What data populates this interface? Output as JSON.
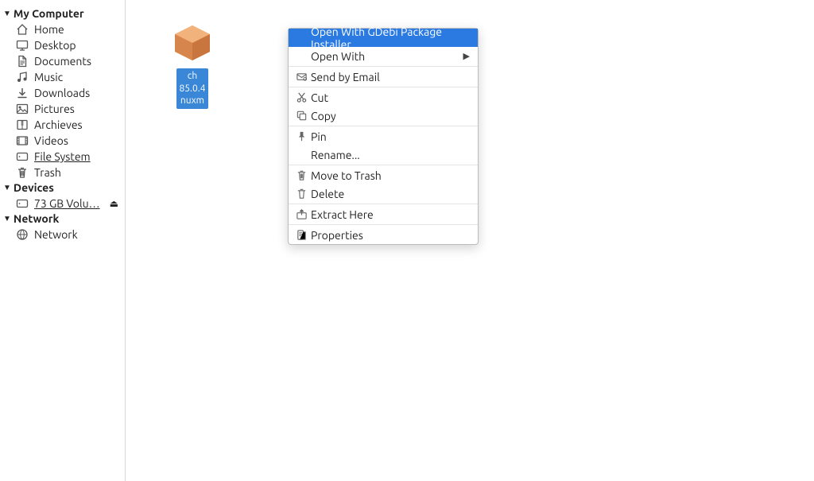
{
  "sidebar": {
    "categories": [
      {
        "name": "My Computer",
        "items": [
          {
            "icon": "home-icon",
            "label": "Home"
          },
          {
            "icon": "desktop-icon",
            "label": "Desktop"
          },
          {
            "icon": "documents-icon",
            "label": "Documents"
          },
          {
            "icon": "music-icon",
            "label": "Music"
          },
          {
            "icon": "downloads-icon",
            "label": "Downloads"
          },
          {
            "icon": "pictures-icon",
            "label": "Pictures"
          },
          {
            "icon": "archives-icon",
            "label": "Archieves"
          },
          {
            "icon": "videos-icon",
            "label": "Videos"
          },
          {
            "icon": "filesystem-icon",
            "label": "File System",
            "underline": true
          },
          {
            "icon": "trash-icon",
            "label": "Trash"
          }
        ]
      },
      {
        "name": "Devices",
        "items": [
          {
            "icon": "volume-icon",
            "label": "73 GB Volu…",
            "underline": true,
            "eject": true
          }
        ]
      },
      {
        "name": "Network",
        "items": [
          {
            "icon": "network-icon",
            "label": "Network"
          }
        ]
      }
    ]
  },
  "file": {
    "selected": true,
    "icon": "deb-package-icon",
    "name_line1": "ch",
    "name_line2": "85.0.4",
    "name_line3": "nuxm"
  },
  "context_menu": {
    "highlighted_index": 0,
    "items": [
      {
        "icon": "",
        "label": "Open With GDebi Package Installer"
      },
      {
        "icon": "",
        "label": "Open With",
        "submenu": true,
        "sep_after": true
      },
      {
        "icon": "mail-icon",
        "label": "Send by Email",
        "sep_after": true
      },
      {
        "icon": "cut-icon",
        "label": "Cut"
      },
      {
        "icon": "copy-icon",
        "label": "Copy",
        "sep_after": true
      },
      {
        "icon": "pin-icon",
        "label": "Pin"
      },
      {
        "icon": "",
        "label": "Rename...",
        "sep_after": true
      },
      {
        "icon": "trash-bin-icon",
        "label": "Move to Trash"
      },
      {
        "icon": "delete-icon",
        "label": "Delete",
        "sep_after": true
      },
      {
        "icon": "extract-icon",
        "label": "Extract Here",
        "sep_after": true
      },
      {
        "icon": "properties-icon",
        "label": "Properties"
      }
    ]
  },
  "icons_svg": {
    "home-icon": "<svg width='16' height='16' viewBox='0 0 16 16'><path fill='none' stroke='#555' stroke-width='1.3' d='M2 8 L8 2 L14 8 M3.5 7 V14 H12.5 V7'/></svg>",
    "desktop-icon": "<svg width='16' height='16' viewBox='0 0 16 16'><rect x='1.5' y='2.5' width='13' height='9' rx='1' fill='none' stroke='#555' stroke-width='1.3'/><path stroke='#555' stroke-width='1.3' d='M5 14 H11 M8 11.5 V14'/></svg>",
    "documents-icon": "<svg width='16' height='16' viewBox='0 0 16 16'><path fill='none' stroke='#555' stroke-width='1.3' d='M4 1.5 H9 L12.5 5 V14.5 H4 Z'/><path fill='none' stroke='#555' stroke-width='1.2' d='M9 1.5 V5 H12.5'/><path stroke='#555' stroke-width='1' d='M5.5 8 H11 M5.5 10 H11 M5.5 12 H9'/></svg>",
    "music-icon": "<svg width='16' height='16' viewBox='0 0 16 16'><path fill='none' stroke='#555' stroke-width='1.3' d='M5.5 12 V3.5 L13 2 V10.5'/><circle cx='4' cy='12' r='2' fill='#555'/><circle cx='11.5' cy='10.5' r='2' fill='#555'/></svg>",
    "downloads-icon": "<svg width='16' height='16' viewBox='0 0 16 16'><path fill='none' stroke='#555' stroke-width='1.5' d='M8 2 V10 M4.5 7 L8 10.5 L11.5 7 M2.5 13.5 H13.5'/></svg>",
    "pictures-icon": "<svg width='16' height='16' viewBox='0 0 16 16'><rect x='1.5' y='2.5' width='13' height='11' rx='1' fill='none' stroke='#555' stroke-width='1.3'/><circle cx='5' cy='6' r='1.5' fill='#555'/><path fill='none' stroke='#555' stroke-width='1.2' d='M2 12 L6 8 L9 11 L11 9 L14 12'/></svg>",
    "archives-icon": "<svg width='16' height='16' viewBox='0 0 16 16'><rect x='2' y='2.5' width='12' height='11' rx='1' fill='none' stroke='#555' stroke-width='1.3'/><path stroke='#555' stroke-width='1' d='M8 3 V13 M6.5 4 H9.5 M6.5 6 H9.5 M6.5 8 H9.5'/></svg>",
    "videos-icon": "<svg width='16' height='16' viewBox='0 0 16 16'><rect x='1.5' y='3' width='13' height='10' rx='1' fill='none' stroke='#555' stroke-width='1.3'/><path stroke='#555' stroke-width='1' d='M4 3 V13 M12 3 V13 M4 5 H1.5 M4 8 H1.5 M4 11 H1.5 M12 5 H14.5 M12 8 H14.5 M12 11 H14.5'/></svg>",
    "filesystem-icon": "<svg width='16' height='16' viewBox='0 0 16 16'><rect x='1.5' y='3.5' width='13' height='9' rx='1.5' fill='none' stroke='#555' stroke-width='1.3'/><circle cx='4.5' cy='8' r='.9' fill='#555'/></svg>",
    "trash-icon": "<svg width='16' height='16' viewBox='0 0 16 16'><path fill='none' stroke='#555' stroke-width='1.3' d='M3 4 H13 M5 4 L5.7 14 H10.3 L11 4 M6 2.5 H10'/><path stroke='#555' stroke-width='1' d='M6.7 6 V12 M8 6 V12 M9.3 6 V12'/></svg>",
    "volume-icon": "<svg width='16' height='16' viewBox='0 0 16 16'><rect x='1.5' y='3.5' width='13' height='9' rx='1.5' fill='none' stroke='#555' stroke-width='1.3'/><circle cx='4.5' cy='8' r='.9' fill='#555'/></svg>",
    "network-icon": "<svg width='16' height='16' viewBox='0 0 16 16'><circle cx='8' cy='8' r='6' fill='none' stroke='#555' stroke-width='1.3'/><path fill='none' stroke='#555' stroke-width='1' d='M2 8 H14 M8 2 C5 4 5 12 8 14 M8 2 C11 4 11 12 8 14'/></svg>",
    "mail-icon": "<svg width='15' height='15' viewBox='0 0 16 16'><rect x='2' y='4' width='12' height='8' rx='1' fill='none' stroke='#666' stroke-width='1.2'/><path fill='none' stroke='#666' stroke-width='1.2' d='M2 5 L8 9 L14 5'/><circle cx='12.5' cy='11' r='2' fill='none' stroke='#666' stroke-width='1'/></svg>",
    "cut-icon": "<svg width='15' height='15' viewBox='0 0 16 16'><circle cx='4.5' cy='12' r='2' fill='none' stroke='#666' stroke-width='1.3'/><circle cx='11.5' cy='12' r='2' fill='none' stroke='#666' stroke-width='1.3'/><path stroke='#666' stroke-width='1.3' d='M5.5 10.5 L12 2 M10.5 10.5 L4 2'/></svg>",
    "copy-icon": "<svg width='15' height='15' viewBox='0 0 16 16'><rect x='2.5' y='2.5' width='8' height='8' rx='1' fill='none' stroke='#666' stroke-width='1.2'/><rect x='5.5' y='5.5' width='8' height='8' rx='1' fill='#fff' stroke='#666' stroke-width='1.2'/></svg>",
    "pin-icon": "<svg width='15' height='15' viewBox='0 0 16 16'><path fill='#666' d='M6 2 H10 L10 7 L12 9 H4 L6 7 Z'/><path stroke='#666' stroke-width='1.3' d='M8 9 V14'/></svg>",
    "trash-bin-icon": "<svg width='15' height='15' viewBox='0 0 16 16'><path fill='none' stroke='#666' stroke-width='1.2' d='M3 4 H13 M5 4 L5.7 14 H10.3 L11 4 M6 2.5 H10'/><path stroke='#666' stroke-width='1' d='M6.7 6 V12 M8 6 V12 M9.3 6 V12'/></svg>",
    "delete-icon": "<svg width='15' height='15' viewBox='0 0 16 16'><path fill='none' stroke='#666' stroke-width='1.2' d='M3 4 H13 M5 4 L5.7 14 H10.3 L11 4 M6 2.5 H10'/></svg>",
    "extract-icon": "<svg width='15' height='15' viewBox='0 0 16 16'><rect x='2' y='6' width='12' height='8' rx='1' fill='none' stroke='#666' stroke-width='1.2'/><path stroke='#666' stroke-width='1.3' d='M8 2 V9 M5.5 4.5 L8 2 L10.5 4.5'/></svg>",
    "properties-icon": "<svg width='15' height='15' viewBox='0 0 16 16'><rect x='3' y='2' width='7' height='12' rx='1' fill='none' stroke='#666' stroke-width='1.2'/><path stroke='#666' stroke-width='1' d='M10 4 H13 V14 H5.5'/><path stroke='#666' stroke-width='.9' d='M4.5 5 H8.5 M4.5 7 H8.5 M4.5 9 H8.5'/></svg>",
    "deb-package-icon": "<svg width='56' height='56' viewBox='0 0 56 56'><polygon points='28,6 50,17 50,39 28,50 6,39 6,17' fill='#e8995a'/><polygon points='28,6 50,17 28,28 6,17' fill='#f2b27c'/><polygon points='6,17 28,28 28,50 6,39' fill='#d6864c'/><polygon points='28,28 50,17 50,39 28,50' fill='#c9763e'/></svg>"
  }
}
